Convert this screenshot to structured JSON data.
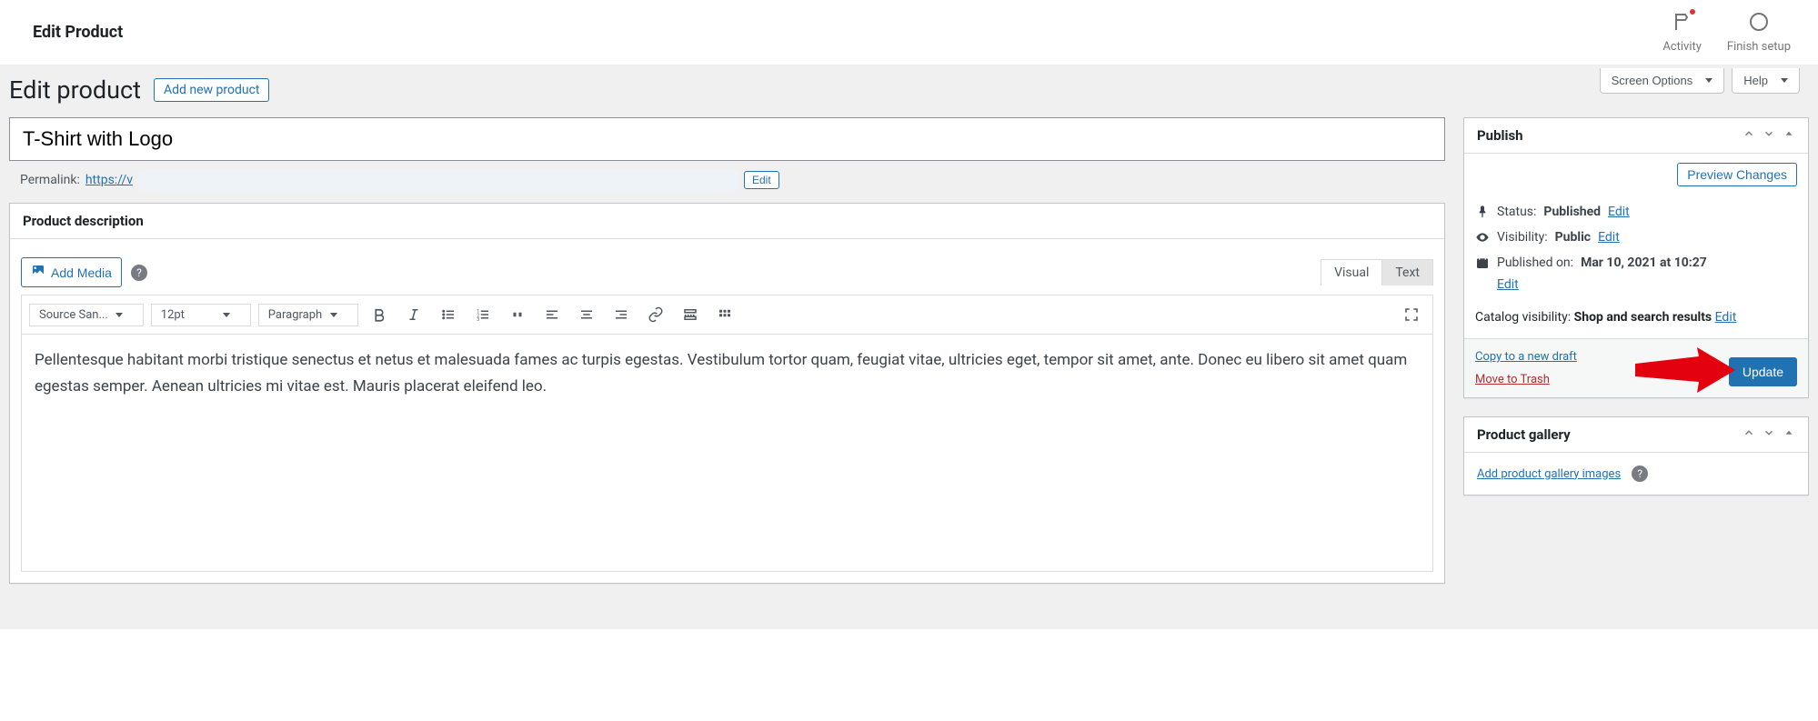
{
  "topbar": {
    "title": "Edit Product",
    "activity_label": "Activity",
    "finish_label": "Finish setup"
  },
  "screen_options": {
    "screen_options_label": "Screen Options",
    "help_label": "Help"
  },
  "page": {
    "heading": "Edit product",
    "add_new_label": "Add new product"
  },
  "title_input": {
    "value": "T-Shirt with Logo"
  },
  "permalink": {
    "label": "Permalink:",
    "link_text": "https://v",
    "edit_label": "Edit"
  },
  "description": {
    "panel_title": "Product description",
    "add_media_label": "Add Media",
    "tab_visual": "Visual",
    "tab_text": "Text",
    "font_select": "Source San...",
    "size_select": "12pt",
    "format_select": "Paragraph",
    "body_text": "Pellentesque habitant morbi tristique senectus et netus et malesuada fames ac turpis egestas. Vestibulum tortor quam, feugiat vitae, ultricies eget, tempor sit amet, ante. Donec eu libero sit amet quam egestas semper. Aenean ultricies mi vitae est. Mauris placerat eleifend leo."
  },
  "publish": {
    "panel_title": "Publish",
    "preview_label": "Preview Changes",
    "status_label": "Status:",
    "status_value": "Published",
    "status_edit": "Edit",
    "visibility_label": "Visibility:",
    "visibility_value": "Public",
    "visibility_edit": "Edit",
    "published_label": "Published on:",
    "published_value": "Mar 10, 2021 at 10:27",
    "published_edit": "Edit",
    "catalog_label": "Catalog visibility:",
    "catalog_value": "Shop and search results",
    "catalog_edit": "Edit",
    "copy_draft": "Copy to a new draft",
    "move_trash": "Move to Trash",
    "update_label": "Update"
  },
  "gallery": {
    "panel_title": "Product gallery",
    "add_link": "Add product gallery images"
  }
}
